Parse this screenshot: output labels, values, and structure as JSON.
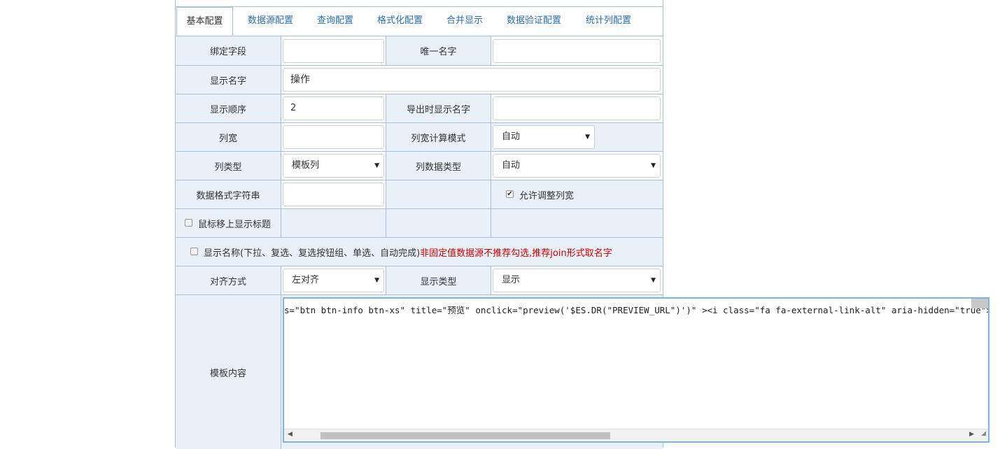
{
  "tabs": [
    "基本配置",
    "数据源配置",
    "查询配置",
    "格式化配置",
    "合并显示",
    "数据验证配置",
    "统计列配置"
  ],
  "fields": {
    "bind_field": {
      "label": "绑定字段",
      "value": ""
    },
    "unique_name": {
      "label": "唯一名字",
      "value": ""
    },
    "display_name": {
      "label": "显示名字",
      "value": "操作"
    },
    "display_order": {
      "label": "显示顺序",
      "value": "2"
    },
    "export_name": {
      "label": "导出时显示名字",
      "value": ""
    },
    "column_width": {
      "label": "列宽",
      "value": ""
    },
    "width_mode": {
      "label": "列宽计算模式",
      "value": "自动"
    },
    "column_type": {
      "label": "列类型",
      "value": "模板列"
    },
    "column_data_type": {
      "label": "列数据类型",
      "value": "自动"
    },
    "format_string": {
      "label": "数据格式字符串",
      "value": ""
    },
    "allow_resize": {
      "label": "允许调整列宽",
      "checked": true
    },
    "hover_title": {
      "label": "鼠标移上显示标题",
      "checked": false
    },
    "show_name": {
      "label": "显示名称(下拉、复选、复选按钮组、单选、自动完成)",
      "warning": "非固定值数据源不推荐勾选,推荐join形式取名字",
      "checked": false
    },
    "align": {
      "label": "对齐方式",
      "value": "左对齐"
    },
    "display_type": {
      "label": "显示类型",
      "value": "显示"
    },
    "template": {
      "label": "模板内容",
      "value": "s=\"btn btn-info btn-xs\" title=\"预览\" onclick=\"preview('$ES.DR(\"PREVIEW_URL\")')\" ><i class=\"fa fa-external-link-alt\" aria-hidden=\"true\"> 预览</i>"
    }
  },
  "colors": {
    "accent": "#2a6ea8",
    "border": "#a9c0db",
    "label_bg": "#eaf0f8",
    "warning": "#d00000"
  }
}
